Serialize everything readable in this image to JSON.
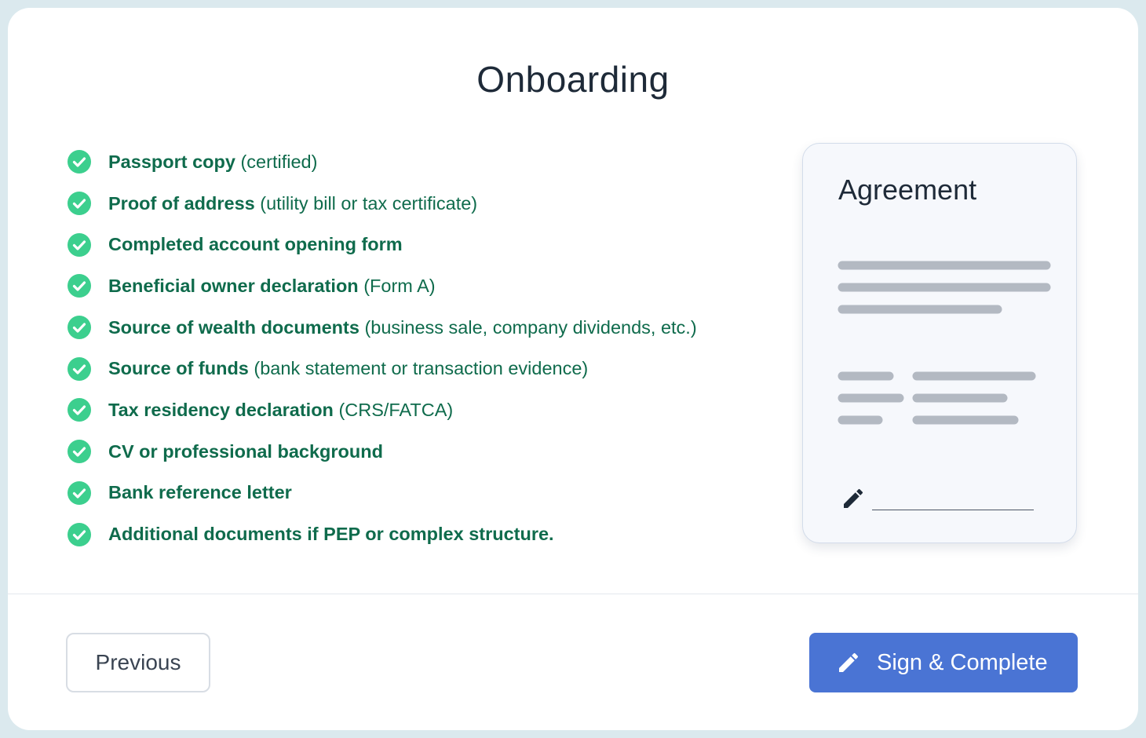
{
  "page": {
    "title": "Onboarding"
  },
  "checklist": [
    {
      "label": "Passport copy",
      "note": "(certified)"
    },
    {
      "label": "Proof of address",
      "note": "(utility bill or tax certificate)"
    },
    {
      "label": "Completed account opening form",
      "note": ""
    },
    {
      "label": "Beneficial owner declaration",
      "note": "(Form A)"
    },
    {
      "label": "Source of wealth documents",
      "note": "(business sale, company dividends, etc.)"
    },
    {
      "label": "Source of funds",
      "note": "(bank statement or transaction evidence)"
    },
    {
      "label": "Tax residency declaration",
      "note": "(CRS/FATCA)"
    },
    {
      "label": "CV or professional background",
      "note": ""
    },
    {
      "label": "Bank reference letter",
      "note": ""
    },
    {
      "label": "Additional documents if PEP or complex structure.",
      "note": ""
    }
  ],
  "agreement": {
    "title": "Agreement",
    "signature_icon": "pencil-icon"
  },
  "footer": {
    "previous_label": "Previous",
    "sign_label": "Sign & Complete",
    "sign_icon": "pencil-icon"
  },
  "colors": {
    "check": "#3ccf8e",
    "item_text": "#0f6b4c",
    "primary": "#4a74d4",
    "placeholder_line": "#b3b9c2"
  }
}
